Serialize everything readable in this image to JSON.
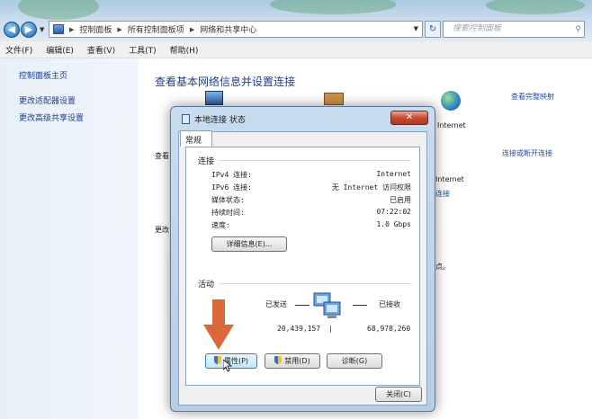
{
  "address_bar": {
    "crumbs": [
      "控制面板",
      "所有控制面板项",
      "网络和共享中心"
    ],
    "search_placeholder": "搜索控制面板"
  },
  "menu": [
    "文件(F)",
    "编辑(E)",
    "查看(V)",
    "工具(T)",
    "帮助(H)"
  ],
  "sidebar": {
    "items": [
      "控制面板主页",
      "更改适配器设置",
      "更改高级共享设置"
    ]
  },
  "main": {
    "title": "查看基本网络信息并设置连接",
    "view_map": "查看完整映射",
    "internet_label": "Internet",
    "connect_link": "连接或断开连接",
    "partial_view": "查看",
    "partial_change": "更改",
    "partial_internet": "Internet",
    "partial_link": "连接",
    "partial_dot": "点。"
  },
  "dialog": {
    "title": "本地连接 状态",
    "close_glyph": "✕",
    "tab": "常规",
    "connection_group": "连接",
    "rows": [
      {
        "label": "IPv4 连接:",
        "value": "Internet"
      },
      {
        "label": "IPv6 连接:",
        "value": "无 Internet 访问权限"
      },
      {
        "label": "媒体状态:",
        "value": "已启用"
      },
      {
        "label": "持续时间:",
        "value": "07:22:02"
      },
      {
        "label": "速度:",
        "value": "1.0 Gbps"
      }
    ],
    "details_button": "详细信息(E)...",
    "activity_group": "活动",
    "sent_label": "已发送",
    "received_label": "已接收",
    "sent_value": "20,439,157",
    "received_value": "68,978,260",
    "properties_button": "属性(P)",
    "disable_button": "禁用(D)",
    "diagnose_button": "诊断(G)",
    "close_button": "关闭(C)"
  },
  "colors": {
    "link_blue": "#1e3e8c",
    "arrow_orange": "#d9683a"
  }
}
